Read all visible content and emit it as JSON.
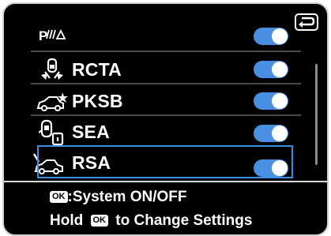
{
  "screen": {
    "background": "#000000",
    "accent": "#4a90e2",
    "highlight": "#3b8fe0"
  },
  "back_icon": "return-arrow-icon",
  "items": [
    {
      "label": "",
      "icon": "p-wave-warning-icon",
      "icon_text": "P",
      "toggle": "on"
    },
    {
      "label": "RCTA",
      "icon": "rear-cross-traffic-icon",
      "toggle": "on"
    },
    {
      "label": "PKSB",
      "icon": "parking-support-brake-icon",
      "toggle": "on"
    },
    {
      "label": "SEA",
      "icon": "safe-exit-assist-icon",
      "toggle": "on"
    },
    {
      "label": "RSA",
      "icon": "road-sign-assist-icon",
      "toggle": "on",
      "selected": true
    }
  ],
  "footer": {
    "ok_chip": "OK",
    "line1_text": ":System ON/OFF",
    "line2_before": "Hold",
    "line2_after": "to Change Settings"
  }
}
